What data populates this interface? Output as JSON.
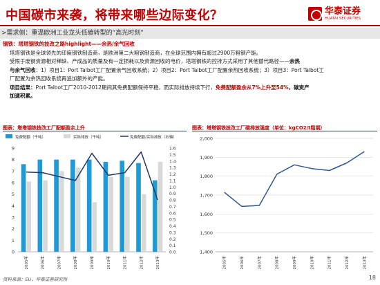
{
  "header": {
    "title": "中国碳市来袭，将带来哪些边际变化？",
    "logo_cn": "华泰证券",
    "logo_en": "HUATAI SECURITIES"
  },
  "subtitle": ">需求侧：重温欧洲工业龙头低碳转型的“高光时刻”",
  "bullets": {
    "heading": "钢铁：塔塔钢铁的技改之路highlight——余热/余气回收",
    "line1": "塔塔钢铁是全球领先的印度钢铁制造商，是欧洲第二大粗钢制造商，在全球范围内拥有超过2900万粗钢产能。",
    "line2_a": "受限于废钢资源相对稀缺、产成品的质量及有一定损耗以及资源回收的电价，塔塔钢铁的控排方式采用了其他替代路径——",
    "line2_b": "余热",
    "line3_a": "与余气回收",
    "line3_b": "：1）项目1：Port Talbot工厂配置余气回收系统；2）项目2：Port Talbot工厂配置余热回收系统；3）项目3：Port Talbot工",
    "line4": "厂配置为余热回收系统再追加额外的产能。",
    "line5_label": "项目结果：",
    "line5_a": "Port Talbot工厂2010-2012期间其免费配额保持平稳，而实际排放持续下行，",
    "line5_b": "免费配额盈余从7%上升至54%",
    "line5_c": "，碳资产",
    "line6": "加速积累。"
  },
  "chart_left_title": "图表：塔塔钢铁技改工厂配额盈余上升",
  "chart_right_title": "图表：塔塔钢铁技改工厂碳排放强度（单位：kgCO2/t粗钢）",
  "source": "资料来源：EU，华泰证券研究所",
  "page_number": "18",
  "colors": {
    "accent": "#c00000",
    "free_allocation": "#1f9ad6",
    "actual_emission": "#d9d9d9",
    "surplus_line": "#1f3864",
    "intensity_line": "#2f5597"
  },
  "chart_data": [
    {
      "type": "bar",
      "categories": [
        "2005年",
        "2006年",
        "2007年",
        "2008年",
        "2009年",
        "2010年",
        "2011年",
        "2012年",
        "2013年"
      ],
      "series": [
        {
          "name": "免费配额（千吨）",
          "type": "bar",
          "axis": "left",
          "values": [
            7.6,
            8.0,
            8.0,
            8.0,
            8.0,
            7.8,
            7.9,
            7.7,
            6.2
          ]
        },
        {
          "name": "实际排放（千吨）",
          "type": "bar",
          "axis": "left",
          "values": [
            6.1,
            6.2,
            7.0,
            7.3,
            4.3,
            6.5,
            6.5,
            5.0,
            7.8
          ]
        },
        {
          "name": "免费配额/实际排放（右轴）",
          "type": "line",
          "axis": "right",
          "values": [
            1.23,
            1.22,
            1.16,
            1.1,
            1.52,
            1.18,
            1.22,
            1.54,
            0.8
          ]
        }
      ],
      "ylim": [
        0,
        9
      ],
      "y_ticks": [
        "0",
        "1",
        "2",
        "3",
        "4",
        "5",
        "6",
        "7",
        "8",
        "9"
      ],
      "y2lim": [
        0,
        1.6
      ],
      "y2_ticks": [
        "0.0",
        "0.1",
        "0.2",
        "0.3",
        "0.4",
        "0.5",
        "0.6",
        "0.7",
        "0.8",
        "0.9",
        "1.0",
        "1.1",
        "1.2",
        "1.3",
        "1.4",
        "1.5",
        "1.6"
      ],
      "legend": "top",
      "grid": false
    },
    {
      "type": "line",
      "categories": [
        "2005年",
        "2006年",
        "2007年",
        "2008年",
        "2009年",
        "2010年",
        "2011年",
        "2012年",
        "2013年"
      ],
      "series": [
        {
          "values": [
            1715,
            1640,
            1645,
            1810,
            1860,
            1840,
            1830,
            1870,
            1930
          ]
        }
      ],
      "ylim": [
        1400,
        2000
      ],
      "y_ticks": [
        "1,400",
        "1,500",
        "1,600",
        "1,700",
        "1,800",
        "1,900",
        "2,000"
      ],
      "grid": true
    }
  ]
}
